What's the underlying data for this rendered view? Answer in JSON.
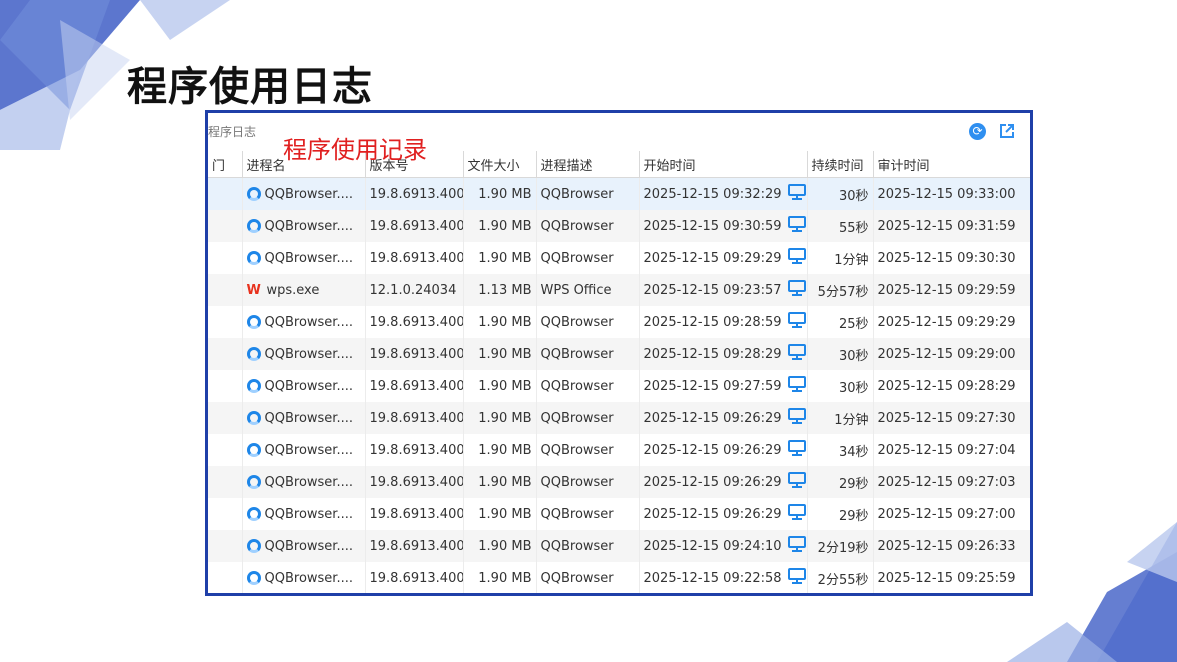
{
  "slide": {
    "title": "程序使用日志",
    "accent_color": "#1f3fa8",
    "caption_color": "#e02020"
  },
  "window": {
    "title": "程序日志",
    "overlay_caption": "程序使用记录",
    "refresh_icon": "refresh-icon",
    "export_icon": "export-icon"
  },
  "table": {
    "columns": [
      "门",
      "进程名",
      "版本号",
      "文件大小",
      "进程描述",
      "开始时间",
      "持续时间",
      "审计时间"
    ],
    "rows": [
      {
        "icon": "qqbrowser-icon",
        "name": "QQBrowser....",
        "version": "19.8.6913.400",
        "size": "1.90 MB",
        "desc": "QQBrowser",
        "start": "2025-12-15 09:32:29",
        "duration": "30秒",
        "audit": "2025-12-15 09:33:00"
      },
      {
        "icon": "qqbrowser-icon",
        "name": "QQBrowser....",
        "version": "19.8.6913.400",
        "size": "1.90 MB",
        "desc": "QQBrowser",
        "start": "2025-12-15 09:30:59",
        "duration": "55秒",
        "audit": "2025-12-15 09:31:59"
      },
      {
        "icon": "qqbrowser-icon",
        "name": "QQBrowser....",
        "version": "19.8.6913.400",
        "size": "1.90 MB",
        "desc": "QQBrowser",
        "start": "2025-12-15 09:29:29",
        "duration": "1分钟",
        "audit": "2025-12-15 09:30:30"
      },
      {
        "icon": "wps-icon",
        "name": "wps.exe",
        "version": "12.1.0.24034",
        "size": "1.13 MB",
        "desc": "WPS Office",
        "start": "2025-12-15 09:23:57",
        "duration": "5分57秒",
        "audit": "2025-12-15 09:29:59"
      },
      {
        "icon": "qqbrowser-icon",
        "name": "QQBrowser....",
        "version": "19.8.6913.400",
        "size": "1.90 MB",
        "desc": "QQBrowser",
        "start": "2025-12-15 09:28:59",
        "duration": "25秒",
        "audit": "2025-12-15 09:29:29"
      },
      {
        "icon": "qqbrowser-icon",
        "name": "QQBrowser....",
        "version": "19.8.6913.400",
        "size": "1.90 MB",
        "desc": "QQBrowser",
        "start": "2025-12-15 09:28:29",
        "duration": "30秒",
        "audit": "2025-12-15 09:29:00"
      },
      {
        "icon": "qqbrowser-icon",
        "name": "QQBrowser....",
        "version": "19.8.6913.400",
        "size": "1.90 MB",
        "desc": "QQBrowser",
        "start": "2025-12-15 09:27:59",
        "duration": "30秒",
        "audit": "2025-12-15 09:28:29"
      },
      {
        "icon": "qqbrowser-icon",
        "name": "QQBrowser....",
        "version": "19.8.6913.400",
        "size": "1.90 MB",
        "desc": "QQBrowser",
        "start": "2025-12-15 09:26:29",
        "duration": "1分钟",
        "audit": "2025-12-15 09:27:30"
      },
      {
        "icon": "qqbrowser-icon",
        "name": "QQBrowser....",
        "version": "19.8.6913.400",
        "size": "1.90 MB",
        "desc": "QQBrowser",
        "start": "2025-12-15 09:26:29",
        "duration": "34秒",
        "audit": "2025-12-15 09:27:04"
      },
      {
        "icon": "qqbrowser-icon",
        "name": "QQBrowser....",
        "version": "19.8.6913.400",
        "size": "1.90 MB",
        "desc": "QQBrowser",
        "start": "2025-12-15 09:26:29",
        "duration": "29秒",
        "audit": "2025-12-15 09:27:03"
      },
      {
        "icon": "qqbrowser-icon",
        "name": "QQBrowser....",
        "version": "19.8.6913.400",
        "size": "1.90 MB",
        "desc": "QQBrowser",
        "start": "2025-12-15 09:26:29",
        "duration": "29秒",
        "audit": "2025-12-15 09:27:00"
      },
      {
        "icon": "qqbrowser-icon",
        "name": "QQBrowser....",
        "version": "19.8.6913.400",
        "size": "1.90 MB",
        "desc": "QQBrowser",
        "start": "2025-12-15 09:24:10",
        "duration": "2分19秒",
        "audit": "2025-12-15 09:26:33"
      },
      {
        "icon": "qqbrowser-icon",
        "name": "QQBrowser....",
        "version": "19.8.6913.400",
        "size": "1.90 MB",
        "desc": "QQBrowser",
        "start": "2025-12-15 09:22:58",
        "duration": "2分55秒",
        "audit": "2025-12-15 09:25:59"
      }
    ]
  }
}
